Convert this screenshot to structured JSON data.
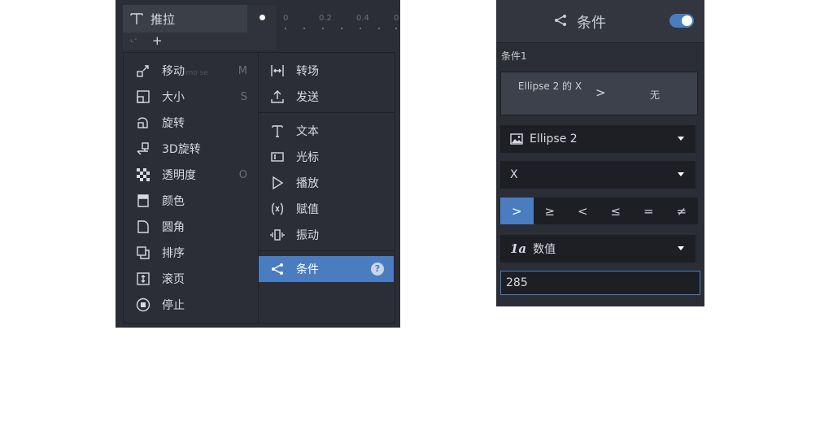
{
  "track": {
    "title": "推拉",
    "add_symbol": "+",
    "corner_symbol": "⌞-",
    "timeline_ticks": [
      "0",
      "0.2",
      "0.4",
      "0"
    ]
  },
  "menu": {
    "ghost_text": "imo se",
    "left_items": [
      {
        "label": "移动",
        "key": "M",
        "icon": "move-icon"
      },
      {
        "label": "大小",
        "key": "S",
        "icon": "scale-icon"
      },
      {
        "label": "旋转",
        "key": "",
        "icon": "rotate-icon"
      },
      {
        "label": "3D旋转",
        "key": "",
        "icon": "rotate-3d-icon"
      },
      {
        "label": "透明度",
        "key": "O",
        "icon": "opacity-icon"
      },
      {
        "label": "颜色",
        "key": "",
        "icon": "color-icon"
      },
      {
        "label": "圆角",
        "key": "",
        "icon": "corner-radius-icon"
      },
      {
        "label": "排序",
        "key": "",
        "icon": "order-icon"
      },
      {
        "label": "滚页",
        "key": "",
        "icon": "scroll-icon"
      },
      {
        "label": "停止",
        "key": "",
        "icon": "stop-icon"
      }
    ],
    "right_items": [
      {
        "label": "转场",
        "icon": "transition-icon"
      },
      {
        "label": "发送",
        "icon": "send-icon"
      },
      {
        "label": "文本",
        "icon": "text-icon"
      },
      {
        "label": "光标",
        "icon": "cursor-icon"
      },
      {
        "label": "播放",
        "icon": "play-icon"
      },
      {
        "label": "赋值",
        "icon": "assign-icon"
      },
      {
        "label": "振动",
        "icon": "vibrate-icon"
      },
      {
        "label": "条件",
        "icon": "condition-icon"
      }
    ],
    "help_symbol": "?"
  },
  "condition_panel": {
    "title": "条件",
    "toggle_on": true,
    "condition_label": "条件1",
    "summary": {
      "left": "Ellipse 2 的 X",
      "operator": ">",
      "right": "无"
    },
    "target_dropdown": "Ellipse 2",
    "property_dropdown": "X",
    "operators": [
      ">",
      "≥",
      "<",
      "≤",
      "=",
      "≠"
    ],
    "active_operator": ">",
    "type_icon_text": "1a",
    "type_dropdown": "数值",
    "value": "285"
  },
  "colors": {
    "accent": "#4a7cc0",
    "panel_bg": "#2b2e36",
    "field_bg": "#1d1f24"
  }
}
